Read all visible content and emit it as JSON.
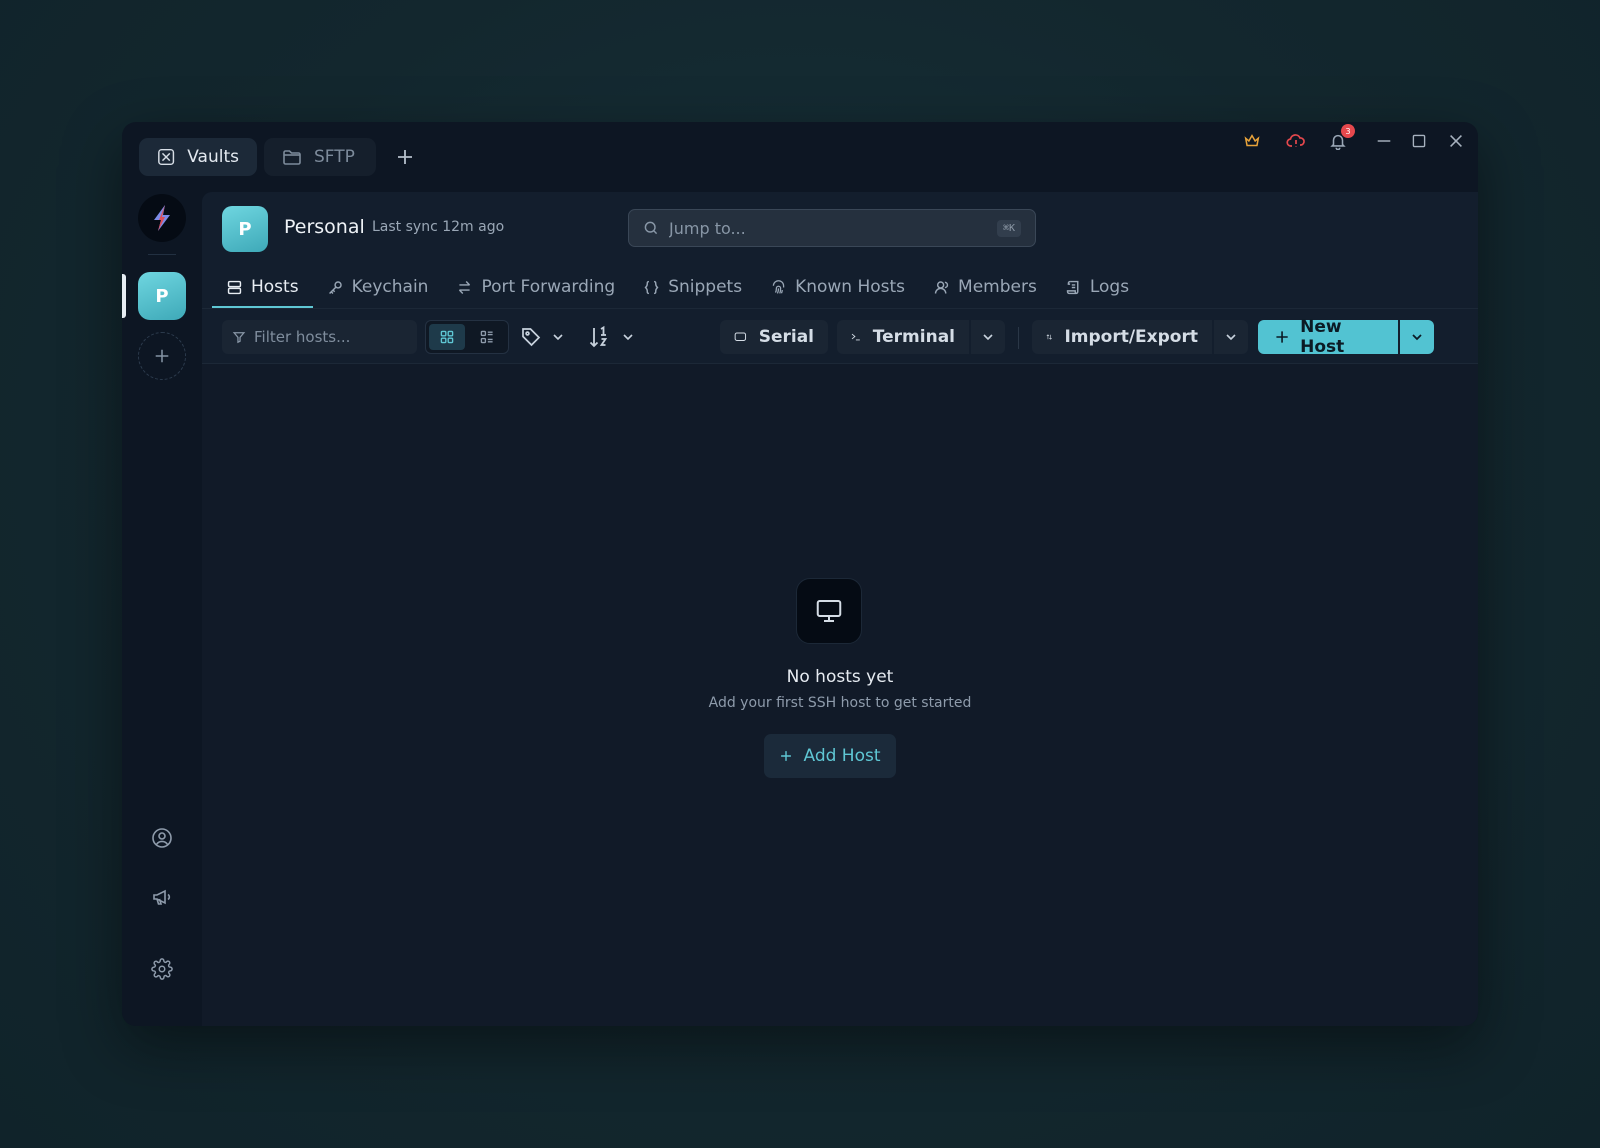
{
  "titlebar": {
    "tabs": [
      {
        "label": "Vaults",
        "icon": "vault-icon"
      },
      {
        "label": "SFTP",
        "icon": "folder-icon"
      }
    ],
    "notification_count": "3"
  },
  "rail": {
    "vault_initial": "P"
  },
  "header": {
    "vault_initial": "P",
    "vault_name": "Personal",
    "sync_status": "Last sync 12m ago",
    "search_placeholder": "Jump to...",
    "search_shortcut": "⌘K"
  },
  "nav": {
    "items": [
      {
        "label": "Hosts",
        "icon": "server-icon",
        "active": true
      },
      {
        "label": "Keychain",
        "icon": "key-icon"
      },
      {
        "label": "Port Forwarding",
        "icon": "arrows-icon"
      },
      {
        "label": "Snippets",
        "icon": "braces-icon"
      },
      {
        "label": "Known Hosts",
        "icon": "fingerprint-icon"
      },
      {
        "label": "Members",
        "icon": "user-icon"
      },
      {
        "label": "Logs",
        "icon": "scroll-icon"
      }
    ]
  },
  "toolbar": {
    "filter_placeholder": "Filter hosts...",
    "serial_label": "Serial",
    "terminal_label": "Terminal",
    "import_export_label": "Import/Export",
    "new_host_label": "New Host"
  },
  "empty_state": {
    "title": "No hosts yet",
    "subtitle": "Add your first SSH host to get started",
    "button_label": "Add Host"
  },
  "colors": {
    "accent": "#52c3d2",
    "background": "#111a28",
    "crown": "#e8a33a",
    "alert": "#e5484d"
  }
}
